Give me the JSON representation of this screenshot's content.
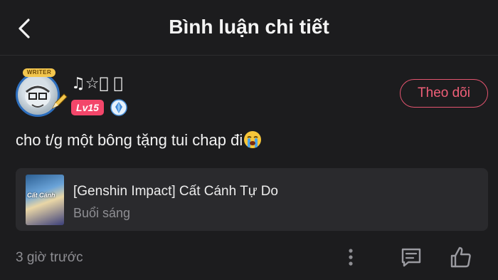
{
  "header": {
    "title": "Bình luận chi tiết",
    "back_icon": "chevron-left-icon"
  },
  "user": {
    "avatar_badge": "WRITER",
    "name": "♫☆ﾟ ﾟ",
    "level": "Lv15",
    "level_color": "#f3466a",
    "follow_label": "Theo dõi",
    "follow_color": "#e3546f"
  },
  "comment": {
    "text": "cho t/g một bông tặng tui chap đi",
    "emoji": "crying-face-emoji"
  },
  "book": {
    "title": "[Genshin Impact] Cất Cánh Tự Do",
    "subtitle": "Buổi sáng",
    "cover_text": "Cất Cánh"
  },
  "footer": {
    "time": "3 giờ trước",
    "icons": [
      "more-vertical-icon",
      "comment-icon",
      "thumbs-up-icon"
    ]
  }
}
